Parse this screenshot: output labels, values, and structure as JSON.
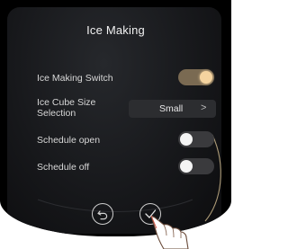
{
  "screen": {
    "title": "Ice Making"
  },
  "settings": {
    "ice_making_switch": {
      "label": "Ice Making Switch",
      "state": "on"
    },
    "ice_cube_size": {
      "label_line1": "Ice Cube Size",
      "label_line2": "Selection",
      "value": "Small",
      "chevron": ">"
    },
    "schedule_open": {
      "label": "Schedule open",
      "state": "off"
    },
    "schedule_off": {
      "label": "Schedule off",
      "state": "off"
    }
  },
  "footer": {
    "back_icon": "undo-arrow-icon",
    "confirm_icon": "checkmark-icon"
  },
  "colors": {
    "accent": "#f4d39f",
    "toggle_on_track": "#7a6a52",
    "toggle_off_track": "#3a3a3d",
    "panel_bg": "#17181b"
  }
}
